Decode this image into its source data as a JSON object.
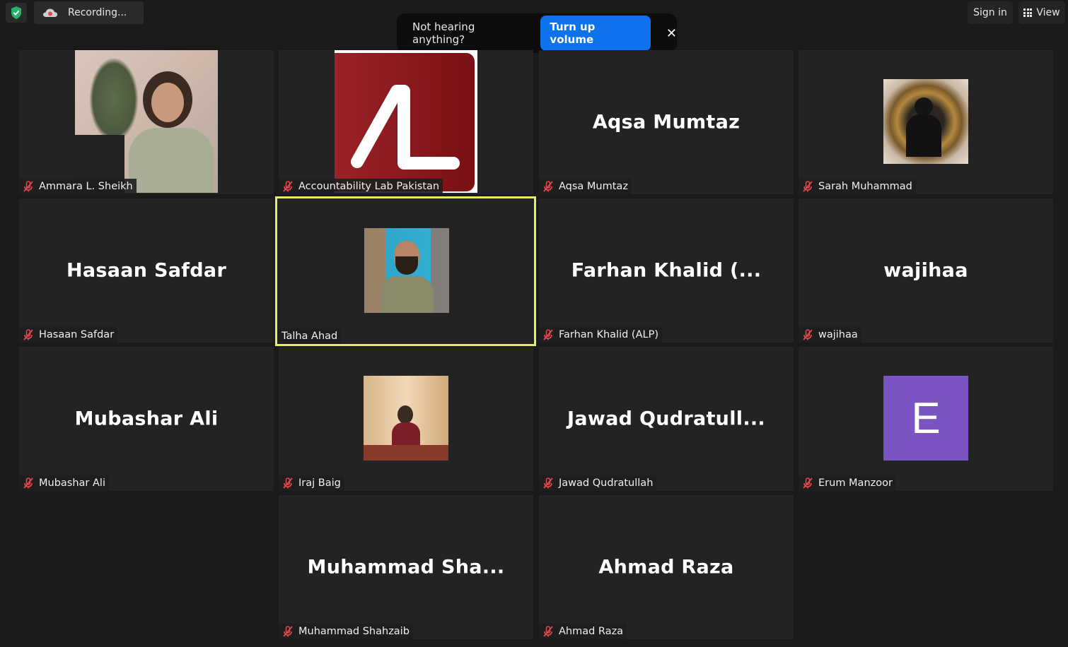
{
  "topbar": {
    "recording_label": "Recording...",
    "sign_in_label": "Sign in",
    "view_label": "View"
  },
  "toast": {
    "message": "Not hearing anything?",
    "action_label": "Turn up volume",
    "close_glyph": "✕"
  },
  "tiles": [
    {
      "name": "Ammara L. Sheikh",
      "big": "",
      "muted": true
    },
    {
      "name": "Accountability Lab Pakistan",
      "big": "",
      "muted": true
    },
    {
      "name": "Aqsa Mumtaz",
      "big": "Aqsa Mumtaz",
      "muted": true
    },
    {
      "name": "Sarah Muhammad",
      "big": "",
      "muted": true
    },
    {
      "name": "Hasaan Safdar",
      "big": "Hasaan Safdar",
      "muted": true
    },
    {
      "name": "Talha Ahad",
      "big": "",
      "muted": false,
      "active": true
    },
    {
      "name": "Farhan Khalid (ALP)",
      "big": "Farhan Khalid (...",
      "muted": true
    },
    {
      "name": "wajihaa",
      "big": "wajihaa",
      "muted": true
    },
    {
      "name": "Mubashar Ali",
      "big": "Mubashar Ali",
      "muted": true
    },
    {
      "name": "Iraj Baig",
      "big": "",
      "muted": true
    },
    {
      "name": "Jawad Qudratullah",
      "big": "Jawad  Qudratull...",
      "muted": true
    },
    {
      "name": "Erum Manzoor",
      "big": "",
      "muted": true,
      "avatar_letter": "E"
    },
    {
      "name": "Muhammad Shahzaib",
      "big": "Muhammad  Sha...",
      "muted": true
    },
    {
      "name": "Ahmad Raza",
      "big": "Ahmad Raza",
      "muted": true
    }
  ],
  "colors": {
    "active_border": "#e6ec6a",
    "accent": "#0e72ed",
    "muted_icon": "#e5484d",
    "avatar_bg": "#7b54c4"
  }
}
